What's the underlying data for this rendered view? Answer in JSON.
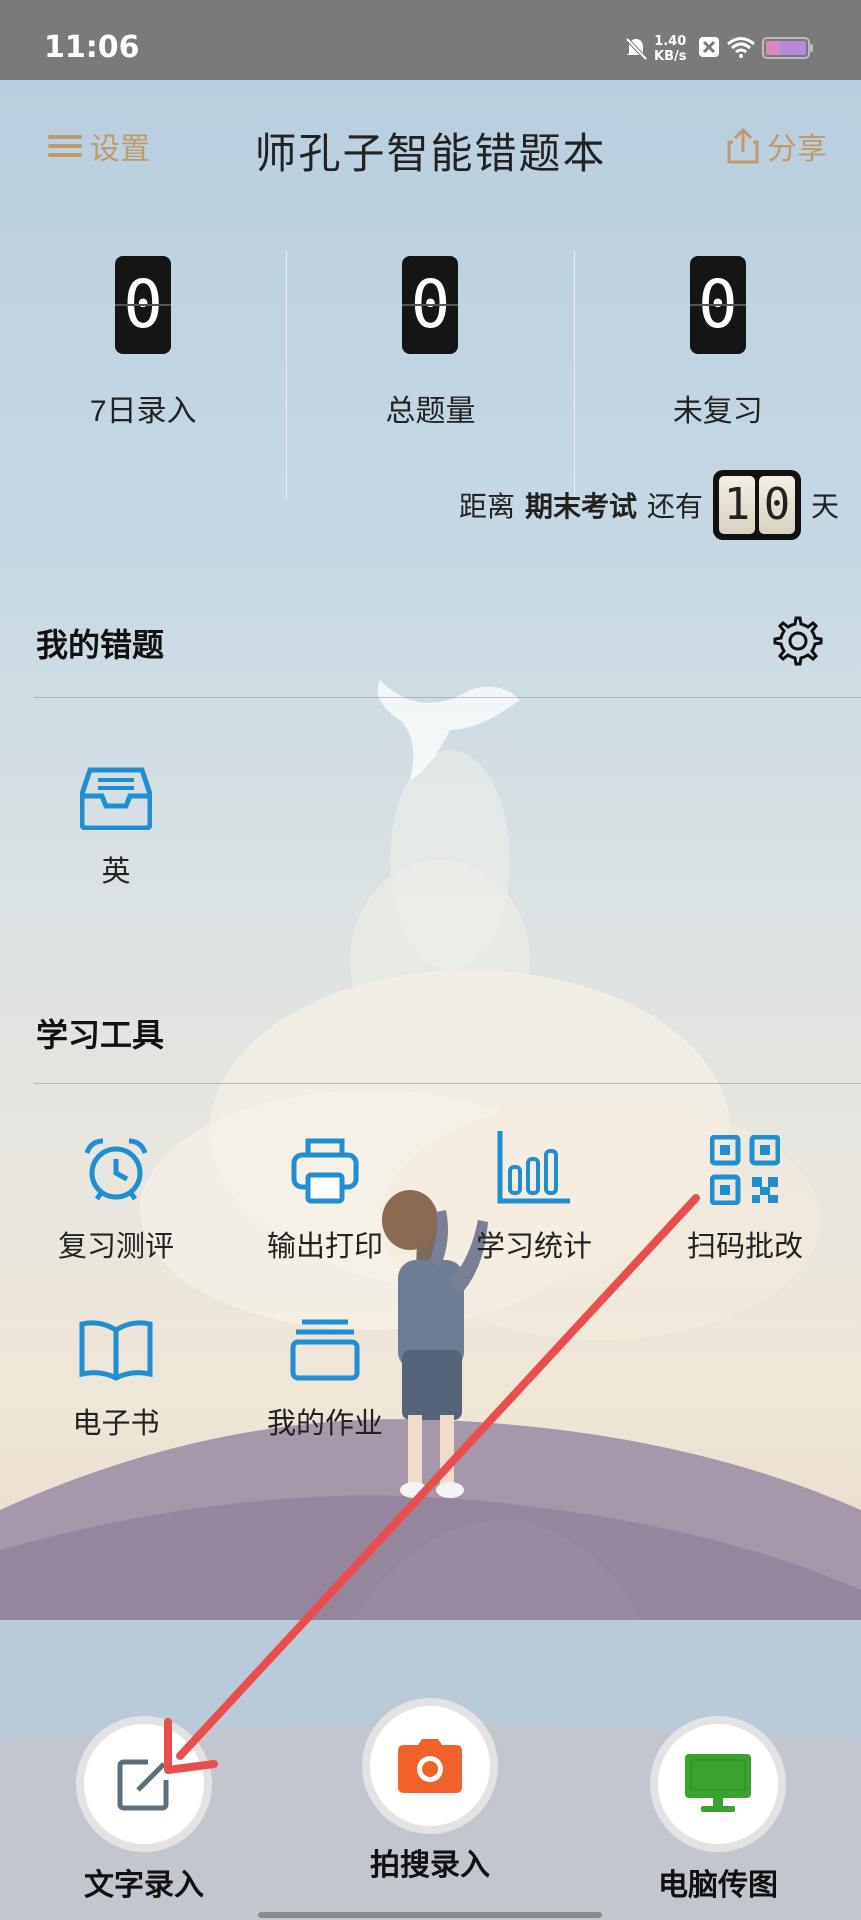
{
  "status_bar": {
    "time": "11:06",
    "net_speed_value": "1.40",
    "net_speed_unit": "KB/s"
  },
  "header": {
    "settings_label": "设置",
    "title": "师孔子智能错题本",
    "share_label": "分享"
  },
  "stats": [
    {
      "value": "0",
      "label": "7日录入"
    },
    {
      "value": "0",
      "label": "总题量"
    },
    {
      "value": "0",
      "label": "未复习"
    }
  ],
  "countdown": {
    "prefix": "距离",
    "exam": "期末考试",
    "middle": "还有",
    "digits": [
      "1",
      "0"
    ],
    "suffix": "天"
  },
  "my_mistakes": {
    "title": "我的错题",
    "items": [
      {
        "label": "英",
        "icon": "inbox-icon"
      }
    ]
  },
  "study_tools": {
    "title": "学习工具",
    "items": [
      {
        "label": "复习测评",
        "icon": "alarm-clock-icon"
      },
      {
        "label": "输出打印",
        "icon": "printer-icon"
      },
      {
        "label": "学习统计",
        "icon": "bar-chart-icon"
      },
      {
        "label": "扫码批改",
        "icon": "qr-code-icon"
      },
      {
        "label": "电子书",
        "icon": "open-book-icon"
      },
      {
        "label": "我的作业",
        "icon": "stack-icon"
      }
    ]
  },
  "bottom_actions": [
    {
      "label": "文字录入",
      "icon": "edit-icon"
    },
    {
      "label": "拍搜录入",
      "icon": "camera-icon"
    },
    {
      "label": "电脑传图",
      "icon": "monitor-icon"
    }
  ],
  "colors": {
    "accent_blue": "#1f8fd1",
    "header_link": "#c09a6c",
    "camera_orange": "#f0622a",
    "monitor_green": "#3aa32e",
    "annotation_arrow": "#ea4d4d"
  }
}
